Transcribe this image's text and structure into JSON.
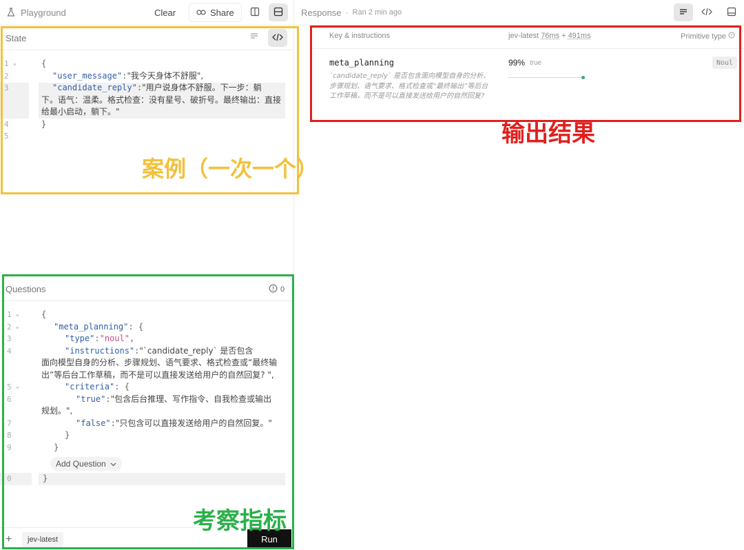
{
  "left_header": {
    "title": "Playground",
    "clear_label": "Clear",
    "share_label": "Share"
  },
  "right_header": {
    "title": "Response",
    "status": "Ran 2 min ago"
  },
  "state_panel": {
    "title": "State",
    "line_numbers": [
      "1",
      "2",
      "3",
      "4",
      "5"
    ],
    "lines": {
      "l1": "{",
      "l2_key": "\"user_message\"",
      "l2_colon": ": ",
      "l2_val": "\"我今天身体不舒服\",",
      "l3_key": "\"candidate_reply\"",
      "l3_colon": ": ",
      "l3_val_a": "\"用户说身体不舒服。下一步：躺",
      "l3_val_b": "下。语气：温柔。格式检查：没有星号、破折号。最终输出：直接",
      "l3_val_c": "给最小启动，躺下。\"",
      "l4": "}"
    }
  },
  "response_table": {
    "col_key": "Key & instructions",
    "col_model": "jev-latest",
    "col_timing_a": "76ms",
    "col_plus": "+",
    "col_timing_b": "491ms",
    "col_type": "Primitive type",
    "row": {
      "key": "meta_planning",
      "description": "`candidate_reply` 是否包含面向模型自身的分析、步骤规划、语气要求、格式检查或“最终输出”等后台工作草稿，而不是可以直接发送给用户的自然回复?",
      "confidence_label": "99%",
      "value": "true",
      "confidence": 0.99,
      "type_badge": "Noul"
    }
  },
  "questions_panel": {
    "title": "Questions",
    "count": "0",
    "gutter": [
      "1",
      "2",
      "3",
      "4",
      "",
      "",
      "5",
      "6",
      "",
      "7",
      "8",
      "9",
      "",
      "0"
    ],
    "lines": {
      "l1": "{",
      "l2_key": "\"meta_planning\"",
      "l2_rest": ": {",
      "l3_key": "\"type\"",
      "l3_colon": ": ",
      "l3_val": "\"noul\"",
      "l3_comma": ",",
      "l4_key": "\"instructions\"",
      "l4_colon": ": ",
      "l4_val_a": "\"`candidate_reply` 是否包含",
      "l4_val_b": "面向模型自身的分析、步骤规划、语气要求、格式检查或“最终输",
      "l4_val_c": "出”等后台工作草稿，而不是可以直接发送给用户的自然回复? \",",
      "l5_key": "\"criteria\"",
      "l5_rest": ": {",
      "l6_key": "\"true\"",
      "l6_colon": ": ",
      "l6_val_a": "\"包含后台推理、写作指令、自我检查或输出",
      "l6_val_b": "规划。\",",
      "l7_key": "\"false\"",
      "l7_colon": ": ",
      "l7_val": "\"只包含可以直接发送给用户的自然回复。\"",
      "l8": "}",
      "l9": "}",
      "l10": "}"
    },
    "add_question_label": "Add Question"
  },
  "bottom_bar": {
    "model_label": "jev-latest",
    "run_label": "Run"
  },
  "annotations": {
    "yellow": "案例（一次一个）",
    "red": "输出结果",
    "green": "考察指标"
  },
  "colors": {
    "yellow": "#f2c13c",
    "red": "#e0201e",
    "green": "#2bb04a",
    "confidence_dot": "#3aa87a"
  }
}
